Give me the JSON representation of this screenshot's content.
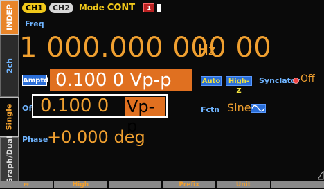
{
  "side_tabs": {
    "indep": "INDEP",
    "two_ch": "2ch",
    "single": "Single",
    "graph_dual": "Graph/Dual"
  },
  "top": {
    "ch1": "CH1",
    "ch2": "CH2",
    "mode_label": "Mode",
    "mode_value": "CONT",
    "mode_badge": "1"
  },
  "freq": {
    "label": "Freq",
    "value": "1 000.000 000 00",
    "unit": "Hz"
  },
  "amplitude": {
    "label": "Amptd",
    "value": "0.100 0 Vp-p",
    "auto": "Auto",
    "highz": "High-Z"
  },
  "synclator": {
    "label": "Synclator",
    "state": "Off",
    "indicator_color": "#f04040"
  },
  "offset": {
    "label": "Of",
    "value": "0.100 0",
    "unit": "Vp-p"
  },
  "function": {
    "label": "Fctn",
    "value": "Sine",
    "icon": "sine-wave-icon"
  },
  "phase": {
    "label": "Phase",
    "value": "+0.000 deg"
  },
  "softkeys": [
    "↦",
    "High",
    "",
    "Prefix",
    "Unit",
    ""
  ],
  "colors": {
    "accent_orange": "#f0a030",
    "value_highlight": "#e07020",
    "label_blue": "#6fb4ff",
    "badge_blue": "#2a6ed8",
    "ch1_yellow": "#f0c81a"
  }
}
